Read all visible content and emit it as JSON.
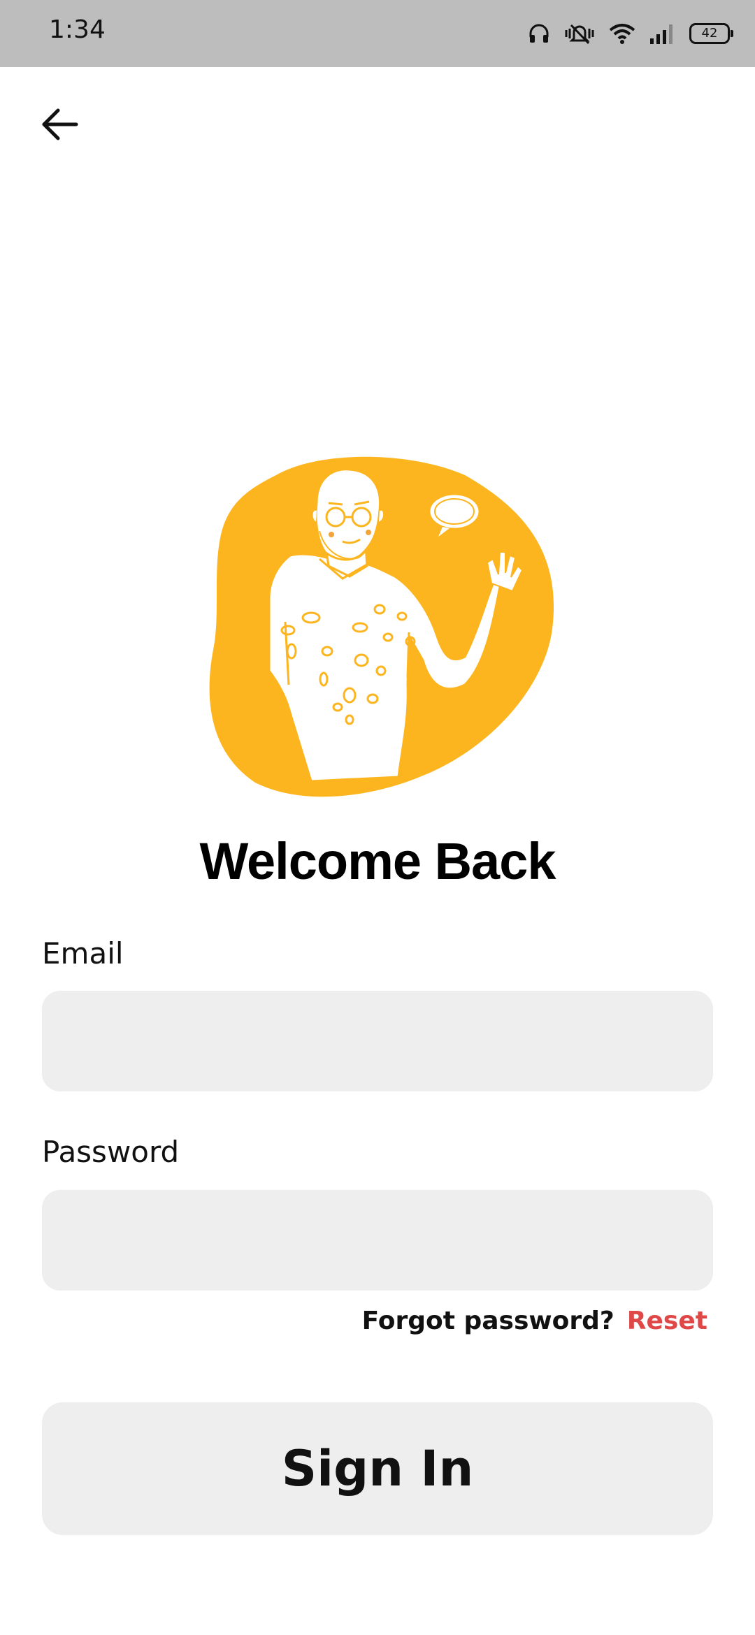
{
  "status_bar": {
    "time": "1:34",
    "battery_level": "42",
    "icons": [
      "headphones-icon",
      "vibrate-mute-icon",
      "wifi-icon",
      "signal-icon",
      "battery-icon"
    ]
  },
  "header": {
    "back_icon": "arrow-left-icon"
  },
  "illustration": {
    "subject": "man-waving-illustration",
    "accent_color": "#FDB51F"
  },
  "main": {
    "title": "Welcome Back",
    "email_label": "Email",
    "email_value": "",
    "email_placeholder": "",
    "password_label": "Password",
    "password_value": "",
    "password_placeholder": "",
    "forgot_text": "Forgot password?",
    "reset_label": "Reset",
    "signin_label": "Sign In"
  },
  "colors": {
    "status_bar_bg": "#BDBDBD",
    "input_bg": "#EEEEEE",
    "reset_link": "#E04848",
    "accent": "#FDB51F"
  }
}
